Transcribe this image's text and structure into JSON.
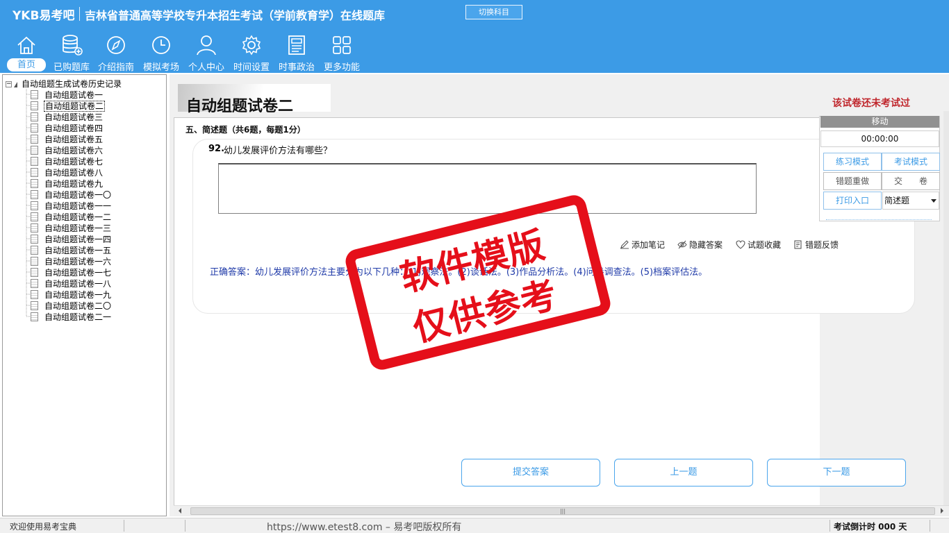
{
  "header": {
    "logo": "YKB易考吧",
    "title": "吉林省普通高等学校专升本招生考试（学前教育学）在线题库",
    "switch_button": "切换科目"
  },
  "nav": [
    {
      "label": "首页",
      "icon": "home-icon"
    },
    {
      "label": "已购题库",
      "icon": "database-icon"
    },
    {
      "label": "介绍指南",
      "icon": "compass-icon"
    },
    {
      "label": "模拟考场",
      "icon": "clock-icon"
    },
    {
      "label": "个人中心",
      "icon": "user-icon"
    },
    {
      "label": "时间设置",
      "icon": "gear-icon"
    },
    {
      "label": "时事政治",
      "icon": "newspaper-icon"
    },
    {
      "label": "更多功能",
      "icon": "grid-icon"
    }
  ],
  "tree": {
    "root": "自动组题生成试卷历史记录",
    "items": [
      "自动组题试卷一",
      "自动组题试卷二",
      "自动组题试卷三",
      "自动组题试卷四",
      "自动组题试卷五",
      "自动组题试卷六",
      "自动组题试卷七",
      "自动组题试卷八",
      "自动组题试卷九",
      "自动组题试卷一〇",
      "自动组题试卷一一",
      "自动组题试卷一二",
      "自动组题试卷一三",
      "自动组题试卷一四",
      "自动组题试卷一五",
      "自动组题试卷一六",
      "自动组题试卷一七",
      "自动组题试卷一八",
      "自动组题试卷一九",
      "自动组题试卷二〇",
      "自动组题试卷二一"
    ],
    "selected_index": 1
  },
  "paper": {
    "title": "自动组题试卷二",
    "status": "该试卷还未考试过",
    "section": "五、简述题（共6题，每题1分）"
  },
  "question": {
    "number": "92.",
    "text": "幼儿发展评价方法有哪些？",
    "answer_value": "",
    "tools": {
      "add_note": "添加笔记",
      "hide_answer": "隐藏答案",
      "favorite": "试题收藏",
      "feedback": "错题反馈"
    },
    "correct_answer": "正确答案：幼儿发展评价方法主要分为以下几种：(1)观察法。(2)谈话法。(3)作品分析法。(4)问卷调查法。(5)档案评估法。"
  },
  "buttons": {
    "submit": "提交答案",
    "prev": "上一题",
    "next": "下一题"
  },
  "float_panel": {
    "move": "移动",
    "timer": "00:00:00",
    "practice_mode": "练习模式",
    "exam_mode": "考试模式",
    "redo_wrong": "错题重做",
    "hand_in": "交　　卷",
    "print": "打印入口",
    "type_select": "简述题"
  },
  "statusbar": {
    "welcome": "欢迎使用易考宝典",
    "url": "https://www.etest8.com – 易考吧版权所有",
    "countdown": "考试倒计时 000 天"
  },
  "watermark": {
    "line1": "软件模版",
    "line2": "仅供参考"
  },
  "colors": {
    "header_bg": "#3c9be6",
    "accent": "#3c9be6",
    "status_red": "#c0272d",
    "answer_blue": "#1f3aa8",
    "stamp_red": "#e50f1a"
  }
}
